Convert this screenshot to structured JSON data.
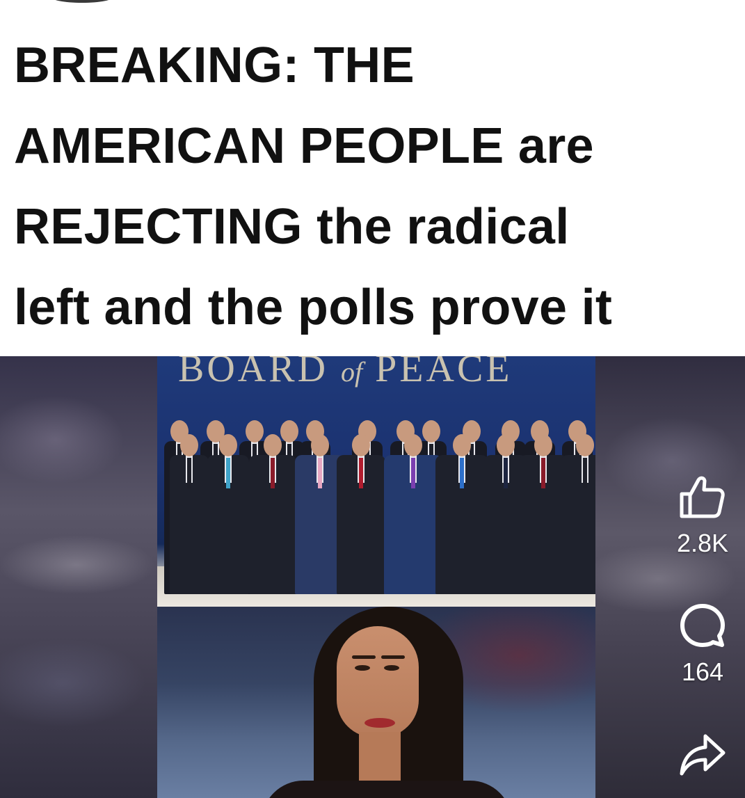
{
  "headline": {
    "line1": "BREAKING: THE",
    "line2_bold": "AMERICAN PEOPLE",
    "line2_rest": " are",
    "line3_bold": "REJECTING",
    "line3_rest": " the radical",
    "line4": "left and the polls prove it"
  },
  "video": {
    "top_photo_backdrop_text": "BOARD",
    "top_photo_backdrop_of": "of",
    "top_photo_backdrop_text2": "PEACE"
  },
  "actions": {
    "like_count": "2.8K",
    "comment_count": "164",
    "icons": [
      "thumbs-up-icon",
      "comment-icon",
      "share-icon"
    ]
  },
  "colors": {
    "text": "#111111",
    "backdrop_blue": "#1f3a7a",
    "icon_white": "#ffffff"
  }
}
